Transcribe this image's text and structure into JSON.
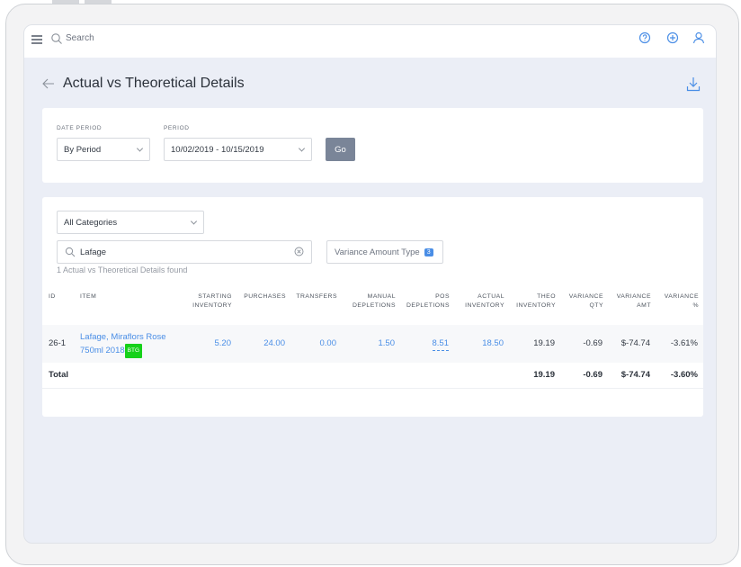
{
  "topbar": {
    "search_placeholder": "Search",
    "icons": [
      "menu-icon",
      "search-icon",
      "help-icon",
      "add-icon",
      "user-icon"
    ]
  },
  "page": {
    "title": "Actual vs Theoretical Details"
  },
  "filters": {
    "date_period_label": "DATE PERIOD",
    "date_period_value": "By Period",
    "period_label": "PERIOD",
    "period_value": "10/02/2019 - 10/15/2019",
    "go_label": "Go"
  },
  "controls": {
    "category_value": "All Categories",
    "search_value": "Lafage",
    "variance_label": "Variance Amount Type",
    "variance_count": "3",
    "found_text": "1 Actual vs Theoretical Details found"
  },
  "table": {
    "headers": {
      "id": "ID",
      "item": "ITEM",
      "starting_1": "STARTING",
      "starting_2": "INVENTORY",
      "purchases": "PURCHASES",
      "transfers": "TRANSFERS",
      "manual_1": "MANUAL",
      "manual_2": "DEPLETIONS",
      "pos_1": "POS",
      "pos_2": "DEPLETIONS",
      "actual_1": "ACTUAL",
      "actual_2": "INVENTORY",
      "theo_1": "THEO",
      "theo_2": "INVENTORY",
      "vqty_1": "VARIANCE",
      "vqty_2": "QTY",
      "vamt_1": "VARIANCE",
      "vamt_2": "AMT",
      "vpct_1": "VARIANCE",
      "vpct_2": "%"
    },
    "row": {
      "id": "26-1",
      "item_line1": "Lafage, Miraflors Rose",
      "item_line2": "750ml 2018",
      "tag": "BTG",
      "starting": "5.20",
      "purchases": "24.00",
      "transfers": "0.00",
      "manual": "1.50",
      "pos": "8.51",
      "actual": "18.50",
      "theo": "19.19",
      "vqty": "-0.69",
      "vamt": "$-74.74",
      "vpct": "-3.61%"
    },
    "total": {
      "label": "Total",
      "theo": "19.19",
      "vqty": "-0.69",
      "vamt": "$-74.74",
      "vpct": "-3.60%"
    }
  },
  "colors": {
    "accent_blue": "#4a8ee6",
    "go_button": "#7a8598",
    "btg_green": "#16d11a",
    "background": "#ebeef6"
  }
}
